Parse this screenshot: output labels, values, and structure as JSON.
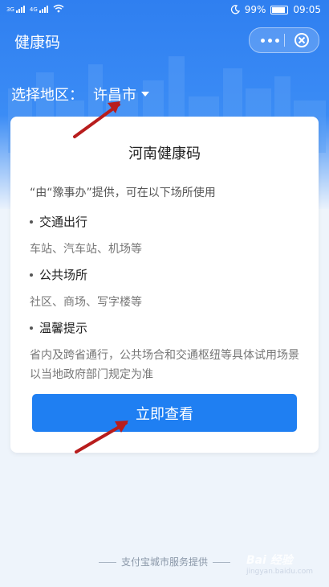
{
  "status_bar": {
    "signal_1": "3G",
    "signal_2": "4G",
    "battery_percent": "99%",
    "time": "09:05"
  },
  "header": {
    "title": "健康码"
  },
  "region": {
    "label": "选择地区：",
    "city": "许昌市"
  },
  "card": {
    "title": "河南健康码",
    "intro": "“由“豫事办”提供，可在以下场所使用",
    "sections": [
      {
        "heading": "交通出行",
        "detail": "车站、汽车站、机场等"
      },
      {
        "heading": "公共场所",
        "detail": "社区、商场、写字楼等"
      },
      {
        "heading": "温馨提示",
        "detail": "省内及跨省通行，公共场合和交通枢纽等具体试用场景以当地政府部门规定为准"
      }
    ],
    "button_label": "立即查看"
  },
  "footer": {
    "text": "支付宝城市服务提供"
  },
  "watermark": {
    "brand": "Bai 经验",
    "url": "jingyan.baidu.com"
  },
  "colors": {
    "primary": "#1f7ff2",
    "header_blue": "#2f7ff0",
    "annotation_arrow": "#b81d1d"
  }
}
